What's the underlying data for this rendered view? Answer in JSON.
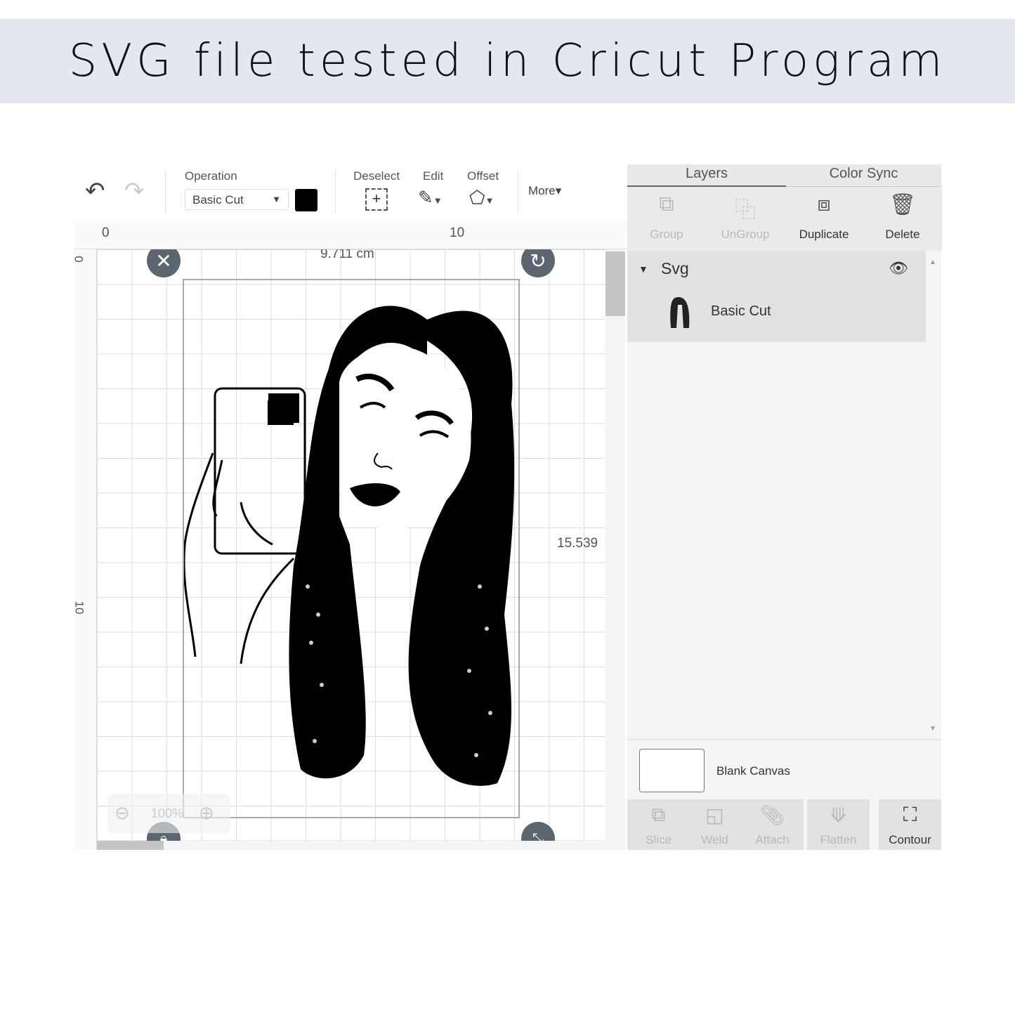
{
  "banner": {
    "title": "SVG file tested in Cricut Program"
  },
  "toolbar": {
    "undo_icon": "undo-icon",
    "redo_icon": "redo-icon",
    "operation_label": "Operation",
    "operation_value": "Basic Cut",
    "operation_color": "#000000",
    "deselect": "Deselect",
    "edit": "Edit",
    "offset": "Offset",
    "more": "More"
  },
  "rulers": {
    "top": [
      "0",
      "10"
    ],
    "left": [
      "0",
      "10"
    ]
  },
  "canvas": {
    "width_label": "9.711 cm",
    "height_label": "15.539",
    "zoom": "100%"
  },
  "panel": {
    "tabs": [
      "Layers",
      "Color Sync"
    ],
    "actions": [
      {
        "label": "Group",
        "enabled": false
      },
      {
        "label": "UnGroup",
        "enabled": false
      },
      {
        "label": "Duplicate",
        "enabled": true
      },
      {
        "label": "Delete",
        "enabled": true
      }
    ],
    "group_name": "Svg",
    "layer_name": "Basic Cut",
    "blank_canvas": "Blank Canvas",
    "bottom": [
      {
        "label": "Slice",
        "enabled": false
      },
      {
        "label": "Weld",
        "enabled": false
      },
      {
        "label": "Attach",
        "enabled": false
      },
      {
        "label": "Flatten",
        "enabled": false
      },
      {
        "label": "Contour",
        "enabled": true
      }
    ]
  }
}
